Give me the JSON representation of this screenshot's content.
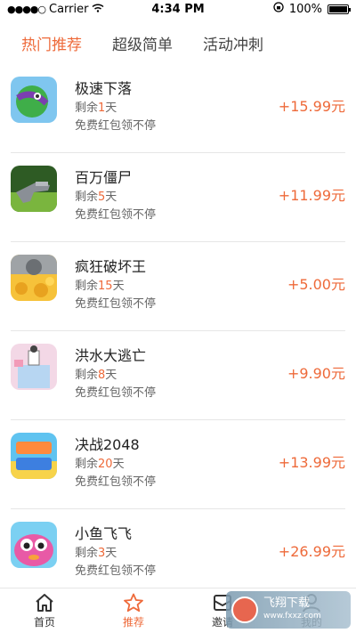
{
  "status": {
    "carrier": "Carrier",
    "time": "4:34 PM",
    "battery": "100%"
  },
  "tabs": [
    {
      "label": "热门推荐",
      "active": true
    },
    {
      "label": "超级简单",
      "active": false
    },
    {
      "label": "活动冲刺",
      "active": false
    }
  ],
  "items": [
    {
      "title": "极速下落",
      "remain_prefix": "剩余",
      "remain_num": "1",
      "remain_suffix": "天",
      "desc": "免费红包领不停",
      "price": "+15.99元"
    },
    {
      "title": "百万僵尸",
      "remain_prefix": "剩余",
      "remain_num": "5",
      "remain_suffix": "天",
      "desc": "免费红包领不停",
      "price": "+11.99元"
    },
    {
      "title": "疯狂破坏王",
      "remain_prefix": "剩余",
      "remain_num": "15",
      "remain_suffix": "天",
      "desc": "免费红包领不停",
      "price": "+5.00元"
    },
    {
      "title": "洪水大逃亡",
      "remain_prefix": "剩余",
      "remain_num": "8",
      "remain_suffix": "天",
      "desc": "免费红包领不停",
      "price": "+9.90元"
    },
    {
      "title": "决战2048",
      "remain_prefix": "剩余",
      "remain_num": "20",
      "remain_suffix": "天",
      "desc": "免费红包领不停",
      "price": "+13.99元"
    },
    {
      "title": "小鱼飞飞",
      "remain_prefix": "剩余",
      "remain_num": "3",
      "remain_suffix": "天",
      "desc": "免费红包领不停",
      "price": "+26.99元"
    }
  ],
  "nav": [
    {
      "label": "首页",
      "icon": "home-icon",
      "active": false
    },
    {
      "label": "推荐",
      "icon": "star-icon",
      "active": true
    },
    {
      "label": "邀请",
      "icon": "envelope-icon",
      "active": false
    },
    {
      "label": "我的",
      "icon": "user-icon",
      "active": false
    }
  ],
  "watermark": {
    "main": "飞翔下载",
    "sub": "www.fxxz.com"
  },
  "colors": {
    "accent": "#ee6a3a",
    "divider": "#e6e6e6"
  }
}
